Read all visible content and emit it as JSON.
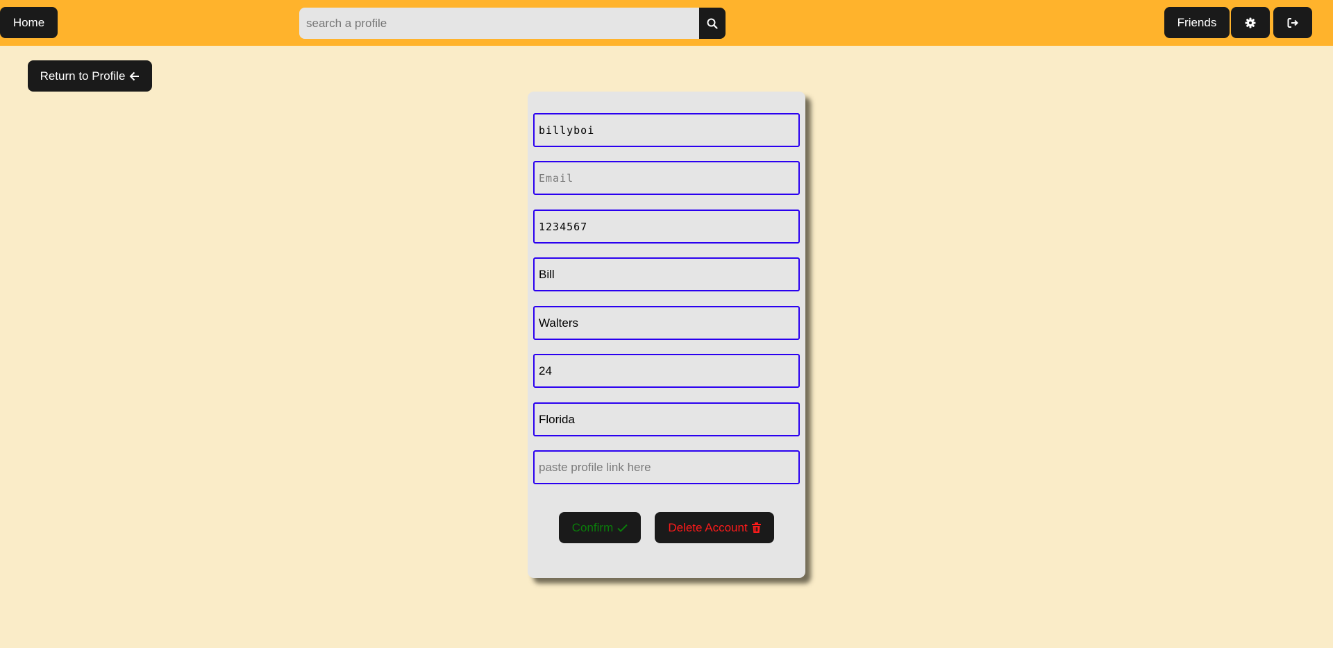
{
  "header": {
    "home_label": "Home",
    "search_placeholder": "search a profile",
    "search_icon": "search-icon",
    "friends_label": "Friends",
    "settings_icon": "gear-icon",
    "logout_icon": "sign-out-icon"
  },
  "return_label": "Return to Profile",
  "form": {
    "username": "billyboi",
    "email_placeholder": "Email",
    "password": "1234567",
    "first_name": "Bill",
    "last_name": "Walters",
    "age": "24",
    "location": "Florida",
    "profile_link_placeholder": "paste profile link here",
    "confirm_label": "Confirm",
    "delete_label": "Delete Account"
  },
  "colors": {
    "header": "#ffb32c",
    "background": "#faecc8",
    "field_border": "#2a00f0",
    "confirm_text": "#0a7d0a",
    "delete_text": "#ff1a1a"
  }
}
